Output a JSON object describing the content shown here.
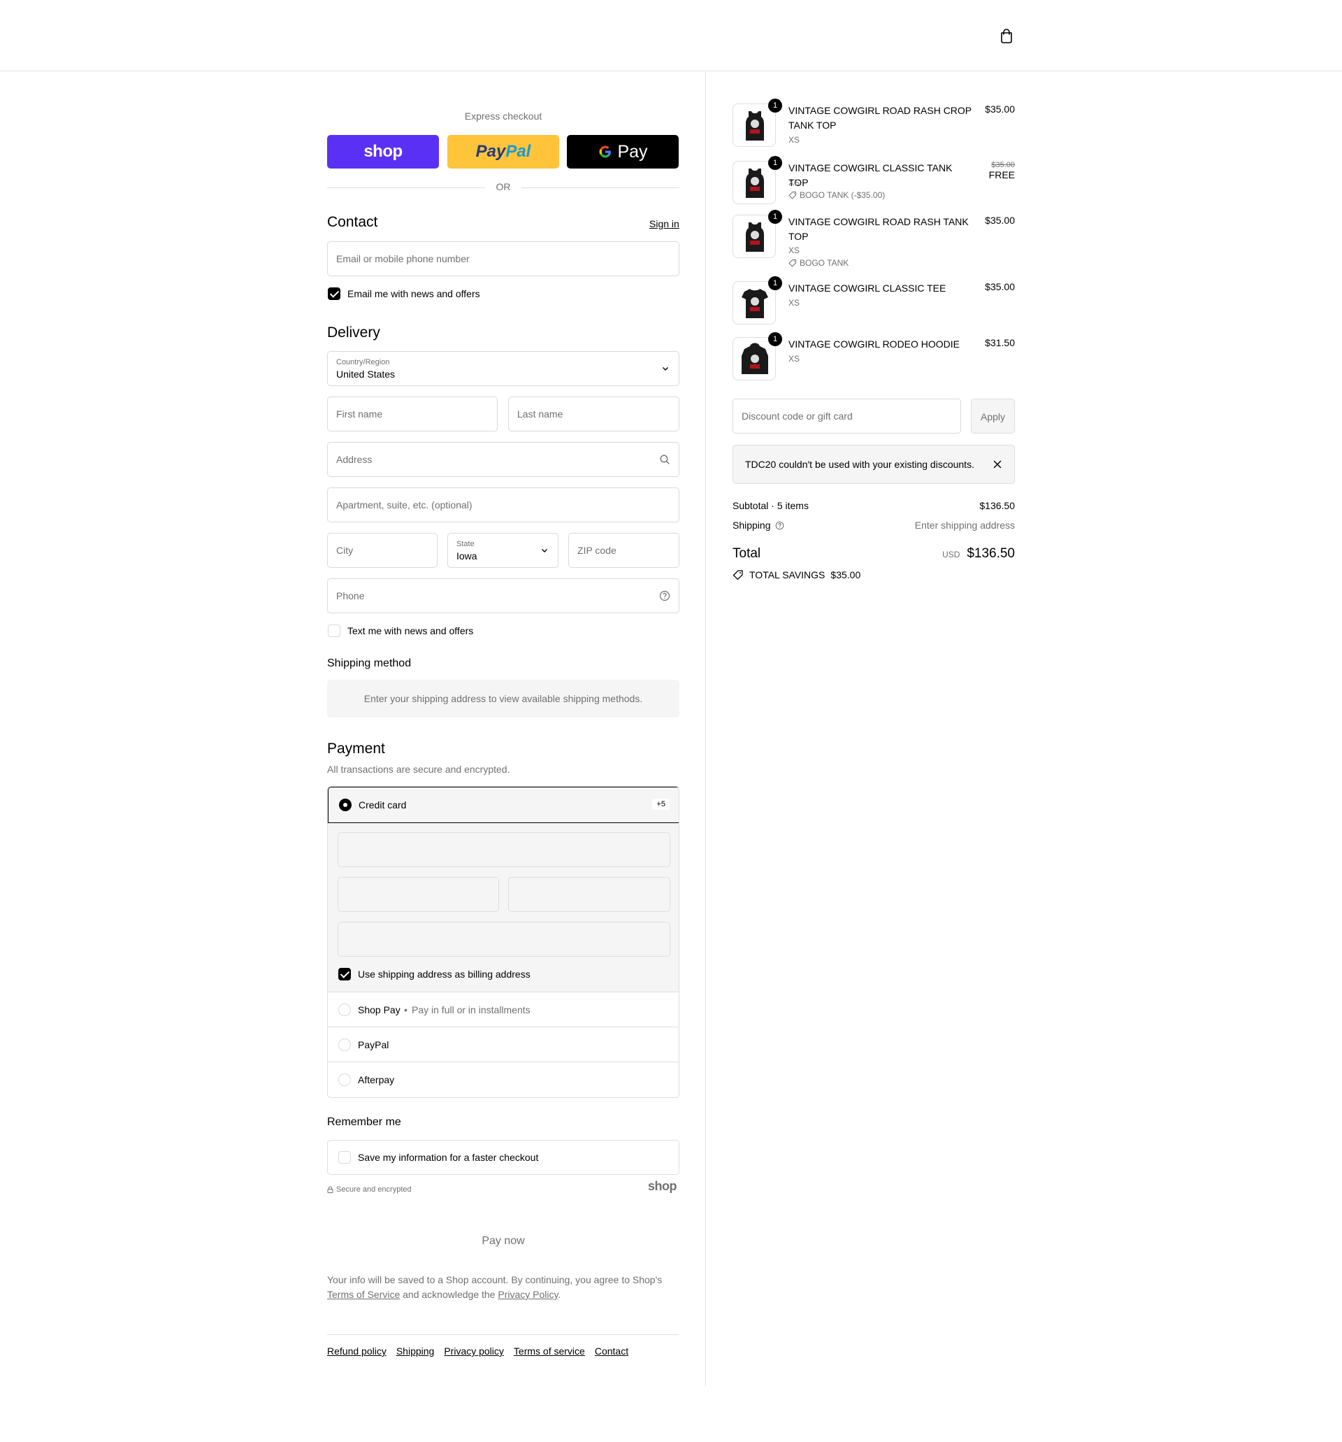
{
  "express": {
    "label": "Express checkout",
    "shop_label": "shop",
    "paypal_a": "Pay",
    "paypal_b": "Pal",
    "gpay_label": "Pay",
    "or_label": "OR"
  },
  "contact": {
    "title": "Contact",
    "sign_in": "Sign in",
    "email_placeholder": "Email or mobile phone number",
    "newsletter_label": "Email me with news and offers"
  },
  "delivery": {
    "title": "Delivery",
    "country_label": "Country/Region",
    "country_value": "United States",
    "first_name": "First name",
    "last_name": "Last name",
    "address": "Address",
    "apartment": "Apartment, suite, etc. (optional)",
    "city": "City",
    "state_label": "State",
    "state_value": "Iowa",
    "zip": "ZIP code",
    "phone": "Phone",
    "sms_label": "Text me with news and offers"
  },
  "shipping_method": {
    "title": "Shipping method",
    "message": "Enter your shipping address to view available shipping methods."
  },
  "payment": {
    "title": "Payment",
    "subtitle": "All transactions are secure and encrypted.",
    "credit_card": "Credit card",
    "more_badge": "+5",
    "billing_label": "Use shipping address as billing address",
    "shop_pay": "Shop Pay",
    "shop_pay_note": "Pay in full or in installments",
    "paypal": "PayPal",
    "afterpay": "Afterpay"
  },
  "remember": {
    "title": "Remember me",
    "save_label": "Save my information for a faster checkout",
    "secure_label": "Secure and encrypted",
    "shop_logo": "shop"
  },
  "pay_now": "Pay now",
  "disclaimer": {
    "text_a": "Your info will be saved to a Shop account. By continuing, you agree to Shop's",
    "terms": "Terms of Service",
    "text_b": "and acknowledge the",
    "privacy": "Privacy Policy",
    "text_c": "."
  },
  "footer": {
    "links": [
      "Refund policy",
      "Shipping",
      "Privacy policy",
      "Terms of service",
      "Contact"
    ]
  },
  "cart": {
    "items": [
      {
        "name": "VINTAGE COWGIRL ROAD RASH CROP TANK TOP",
        "variant": "XS",
        "qty": "1",
        "price": "$35.00",
        "discount": ""
      },
      {
        "name": "VINTAGE COWGIRL CLASSIC TANK TOP",
        "variant": "XS",
        "qty": "1",
        "price": "FREE",
        "old_price": "$35.00",
        "discount": "BOGO TANK (-$35.00)"
      },
      {
        "name": "VINTAGE COWGIRL ROAD RASH TANK TOP",
        "variant": "XS",
        "qty": "1",
        "price": "$35.00",
        "discount": "BOGO TANK"
      },
      {
        "name": "VINTAGE COWGIRL CLASSIC TEE",
        "variant": "XS",
        "qty": "1",
        "price": "$35.00",
        "discount": ""
      },
      {
        "name": "VINTAGE COWGIRL RODEO HOODIE",
        "variant": "XS",
        "qty": "1",
        "price": "$31.50",
        "discount": ""
      }
    ],
    "discount_placeholder": "Discount code or gift card",
    "apply_label": "Apply",
    "notice": "TDC20 couldn't be used with your existing discounts.",
    "subtotal_label": "Subtotal · 5 items",
    "subtotal_value": "$136.50",
    "shipping_label": "Shipping",
    "shipping_value": "Enter shipping address",
    "total_label": "Total",
    "currency": "USD",
    "total_value": "$136.50",
    "savings_label": "TOTAL SAVINGS",
    "savings_value": "$35.00"
  },
  "colors": {
    "shop_purple": "#5a31f4",
    "paypal_yellow": "#ffc439",
    "gpay_black": "#000000",
    "muted_text": "#707070",
    "border": "#d9d9d9"
  }
}
